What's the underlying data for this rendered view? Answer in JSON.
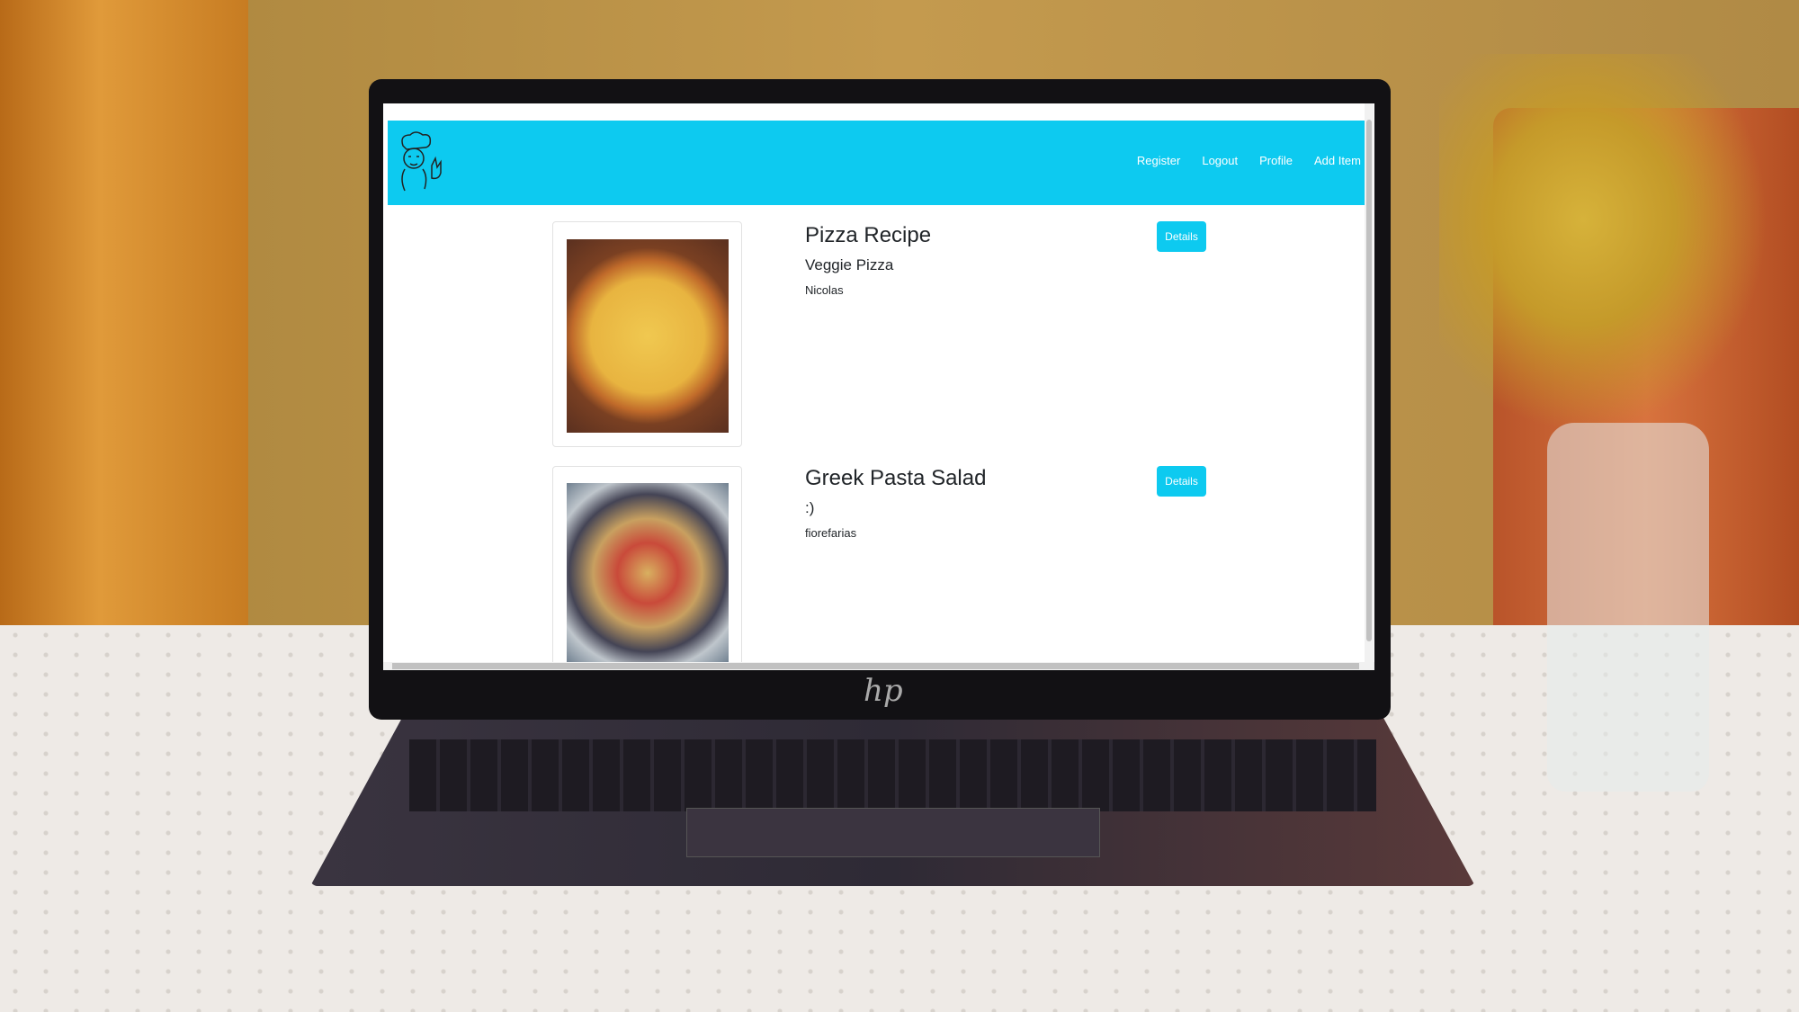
{
  "navbar": {
    "links": [
      "Register",
      "Logout",
      "Profile",
      "Add Item"
    ],
    "color": "#0dcaf0"
  },
  "recipes": [
    {
      "title": "Pizza Recipe",
      "subtitle": "Veggie Pizza",
      "author": "Nicolas",
      "button": "Details"
    },
    {
      "title": "Greek Pasta Salad",
      "subtitle": ":)",
      "author": "fiorefarias",
      "button": "Details"
    }
  ],
  "laptop_brand": "hp"
}
